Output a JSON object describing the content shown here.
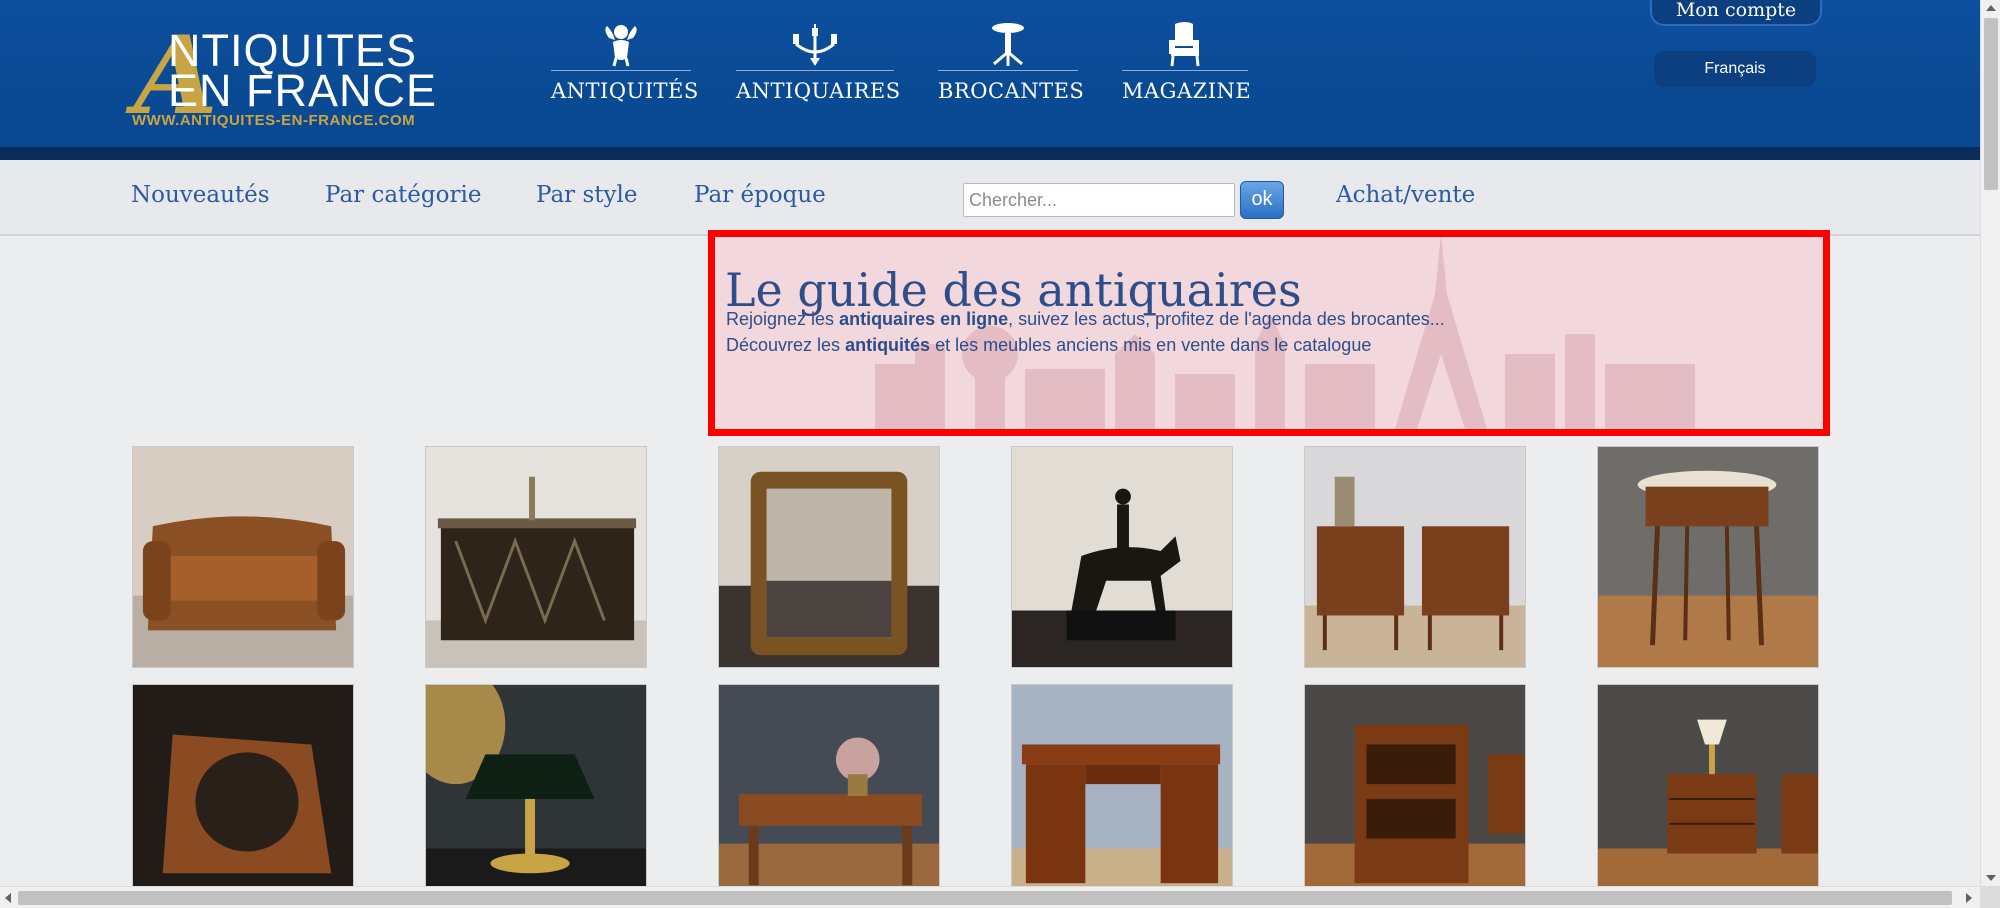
{
  "header": {
    "logo": {
      "letter": "A",
      "line1": "NTIQUITES",
      "line2": "EN FRANCE",
      "url": "WWW.ANTIQUITES-EN-FRANCE.COM"
    },
    "main_nav": [
      {
        "label": "ANTIQUITÉS",
        "icon": "cherub-icon"
      },
      {
        "label": "ANTIQUAIRES",
        "icon": "chandelier-icon"
      },
      {
        "label": "BROCANTES",
        "icon": "pedestal-table-icon"
      },
      {
        "label": "MAGAZINE",
        "icon": "armchair-icon"
      }
    ],
    "account_label": "Mon compte",
    "language": "Français"
  },
  "subnav": {
    "links": [
      "Nouveautés",
      "Par catégorie",
      "Par style",
      "Par époque",
      "Achat/vente"
    ],
    "search_placeholder": "Chercher...",
    "search_button": "ok"
  },
  "banner": {
    "title": "Le guide des antiquaires",
    "line1_prefix": "Rejoignez les ",
    "line1_bold": "antiquaires en ligne",
    "line1_suffix": ", suivez les actus, profitez de l'agenda des brocantes...",
    "line2_prefix": "Découvrez les ",
    "line2_bold": "antiquités",
    "line2_suffix": " et les meubles anciens mis en vente dans le catalogue"
  },
  "products": [
    {
      "name": "leather-sofa-photo"
    },
    {
      "name": "dark-cabinet-photo"
    },
    {
      "name": "gilt-mirror-photo"
    },
    {
      "name": "horse-rider-bronze-photo"
    },
    {
      "name": "pair-nightstands-photo"
    },
    {
      "name": "round-side-table-photo"
    },
    {
      "name": "wooden-stand-photo"
    },
    {
      "name": "bouillotte-lamp-photo"
    },
    {
      "name": "coffee-table-photo"
    },
    {
      "name": "wooden-desk-photo"
    },
    {
      "name": "revolving-bookcase-photo"
    },
    {
      "name": "small-chest-drawers-photo"
    }
  ],
  "colors": {
    "header_blue": "#0a4a94",
    "gold": "#c8a445",
    "link_blue": "#2c5aa0",
    "highlight_red": "#ff0000"
  }
}
